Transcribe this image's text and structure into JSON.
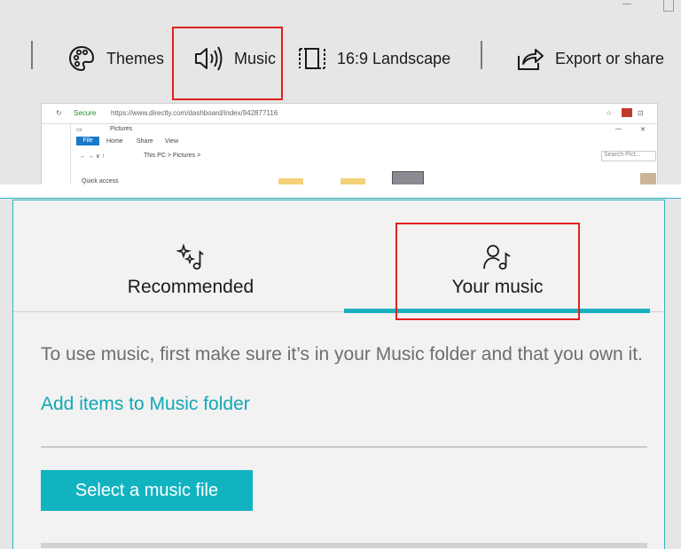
{
  "toolbar": {
    "themes": {
      "label": "Themes",
      "icon": "palette-icon"
    },
    "music": {
      "label": "Music",
      "icon": "speaker-icon"
    },
    "aspect": {
      "label": "16:9 Landscape",
      "icon": "aspect-ratio-icon"
    },
    "export": {
      "label": "Export or share",
      "icon": "share-icon"
    }
  },
  "preview": {
    "secure_label": "Secure",
    "url": "https://www.directly.com/dashboard/index/942877116",
    "explorer_title": "Pictures",
    "ribbon_tabs": [
      "File",
      "Home",
      "Share",
      "View"
    ],
    "path": "This PC  >  Pictures  >",
    "search_placeholder": "Search Pict...",
    "quick_access": "Quick access"
  },
  "music_panel": {
    "tabs": [
      {
        "label": "Recommended",
        "icon": "sparkle-music-icon",
        "selected": false
      },
      {
        "label": "Your music",
        "icon": "person-music-icon",
        "selected": true
      }
    ],
    "info_text": "To use music, first make sure it’s in your Music folder and that you own it.",
    "link_text": "Add items to Music folder",
    "select_button": "Select a music file"
  },
  "colors": {
    "accent": "#12b3c1",
    "highlight_box": "#e02020",
    "link": "#10a8b6"
  }
}
